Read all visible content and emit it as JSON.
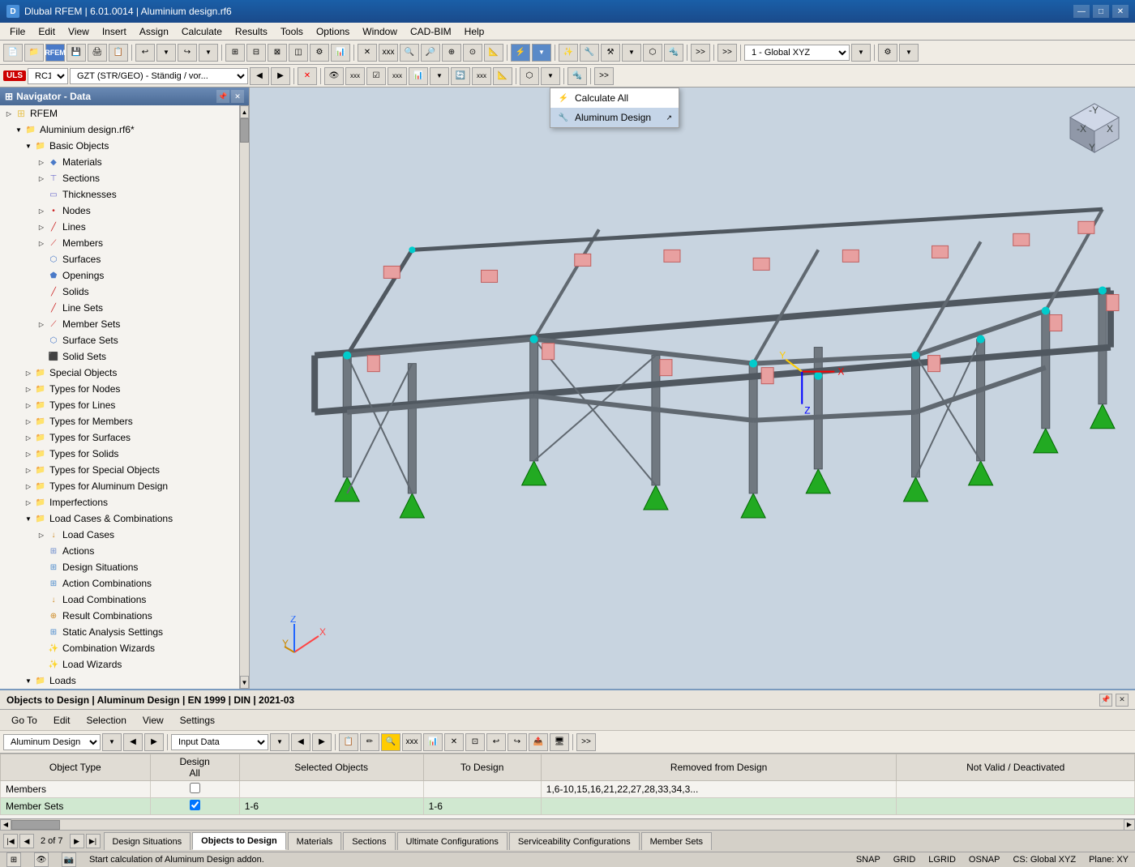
{
  "titleBar": {
    "title": "Dlubal RFEM | 6.01.0014 | Aluminium design.rf6",
    "icon": "D",
    "minBtn": "—",
    "maxBtn": "□",
    "closeBtn": "✕"
  },
  "menuBar": {
    "items": [
      "File",
      "Edit",
      "View",
      "Insert",
      "Assign",
      "Calculate",
      "Results",
      "Tools",
      "Options",
      "Window",
      "CAD-BIM",
      "Help"
    ]
  },
  "toolbar1": {
    "buttons": [
      "📁",
      "💾",
      "🔄",
      "📋",
      "✂",
      "📌",
      "🖨",
      "↩",
      "↪"
    ]
  },
  "toolbar2": {
    "badge": "ULS",
    "combo1": "RC1",
    "combo2": "GZT (STR/GEO) - Ständig / vor...",
    "combo3": "1 - Global XYZ"
  },
  "navigator": {
    "title": "Navigator - Data",
    "rootLabel": "RFEM",
    "items": [
      {
        "label": "Aluminium design.rf6*",
        "level": 1,
        "expanded": true,
        "type": "file"
      },
      {
        "label": "Basic Objects",
        "level": 2,
        "expanded": true,
        "type": "folder"
      },
      {
        "label": "Materials",
        "level": 3,
        "expanded": false,
        "type": "leaf"
      },
      {
        "label": "Sections",
        "level": 3,
        "expanded": false,
        "type": "leaf"
      },
      {
        "label": "Thicknesses",
        "level": 3,
        "expanded": false,
        "type": "leaf"
      },
      {
        "label": "Nodes",
        "level": 3,
        "expanded": false,
        "type": "leaf"
      },
      {
        "label": "Lines",
        "level": 3,
        "expanded": false,
        "type": "leaf"
      },
      {
        "label": "Members",
        "level": 3,
        "expanded": false,
        "type": "leaf"
      },
      {
        "label": "Surfaces",
        "level": 3,
        "expanded": false,
        "type": "leaf"
      },
      {
        "label": "Openings",
        "level": 3,
        "expanded": false,
        "type": "leaf"
      },
      {
        "label": "Solids",
        "level": 3,
        "expanded": false,
        "type": "leaf"
      },
      {
        "label": "Line Sets",
        "level": 3,
        "expanded": false,
        "type": "leaf"
      },
      {
        "label": "Member Sets",
        "level": 3,
        "expanded": false,
        "type": "leaf"
      },
      {
        "label": "Surface Sets",
        "level": 3,
        "expanded": false,
        "type": "leaf"
      },
      {
        "label": "Solid Sets",
        "level": 3,
        "expanded": false,
        "type": "leaf"
      },
      {
        "label": "Special Objects",
        "level": 2,
        "expanded": false,
        "type": "folder"
      },
      {
        "label": "Types for Nodes",
        "level": 2,
        "expanded": false,
        "type": "folder"
      },
      {
        "label": "Types for Lines",
        "level": 2,
        "expanded": false,
        "type": "folder"
      },
      {
        "label": "Types for Members",
        "level": 2,
        "expanded": false,
        "type": "folder"
      },
      {
        "label": "Types for Surfaces",
        "level": 2,
        "expanded": false,
        "type": "folder"
      },
      {
        "label": "Types for Solids",
        "level": 2,
        "expanded": false,
        "type": "folder"
      },
      {
        "label": "Types for Special Objects",
        "level": 2,
        "expanded": false,
        "type": "folder"
      },
      {
        "label": "Types for Aluminum Design",
        "level": 2,
        "expanded": false,
        "type": "folder"
      },
      {
        "label": "Imperfections",
        "level": 2,
        "expanded": false,
        "type": "folder"
      },
      {
        "label": "Load Cases & Combinations",
        "level": 2,
        "expanded": true,
        "type": "folder"
      },
      {
        "label": "Load Cases",
        "level": 3,
        "expanded": false,
        "type": "leaf"
      },
      {
        "label": "Actions",
        "level": 3,
        "expanded": false,
        "type": "leaf"
      },
      {
        "label": "Design Situations",
        "level": 3,
        "expanded": false,
        "type": "leaf",
        "selected": false
      },
      {
        "label": "Action Combinations",
        "level": 3,
        "expanded": false,
        "type": "leaf"
      },
      {
        "label": "Load Combinations",
        "level": 3,
        "expanded": false,
        "type": "leaf"
      },
      {
        "label": "Result Combinations",
        "level": 3,
        "expanded": false,
        "type": "leaf"
      },
      {
        "label": "Static Analysis Settings",
        "level": 3,
        "expanded": false,
        "type": "leaf"
      },
      {
        "label": "Combination Wizards",
        "level": 3,
        "expanded": false,
        "type": "leaf"
      },
      {
        "label": "Load Wizards",
        "level": 3,
        "expanded": false,
        "type": "leaf"
      },
      {
        "label": "Loads",
        "level": 2,
        "expanded": false,
        "type": "folder"
      }
    ]
  },
  "dropdownMenu": {
    "items": [
      {
        "label": "Calculate All",
        "icon": "⚡"
      },
      {
        "label": "Aluminum Design",
        "icon": "🔧"
      }
    ]
  },
  "bottomPanel": {
    "title": "Objects to Design | Aluminum Design | EN 1999 | DIN | 2021-03",
    "menuItems": [
      "Go To",
      "Edit",
      "Selection",
      "View",
      "Settings"
    ],
    "moduleDropdown": "Aluminum Design",
    "dataDropdown": "Input Data",
    "tableHeaders": [
      "Object Type",
      "Design\nAll",
      "Selected Objects",
      "To Design",
      "Removed from Design",
      "Not Valid / Deactivated"
    ],
    "tableRows": [
      {
        "type": "Members",
        "designAll": false,
        "selected": "",
        "toDesign": "",
        "removed": "1,6-10,15,16,21,22,27,28,33,34,3...",
        "notValid": ""
      },
      {
        "type": "Member Sets",
        "designAll": true,
        "selected": "1-6",
        "toDesign": "1-6",
        "removed": "",
        "notValid": ""
      }
    ],
    "pagination": {
      "current": "2",
      "total": "7",
      "label": "of 7"
    },
    "tabs": [
      "Design Situations",
      "Objects to Design",
      "Materials",
      "Sections",
      "Ultimate Configurations",
      "Serviceability Configurations",
      "Member Sets"
    ]
  },
  "statusBar": {
    "message": "Start calculation of Aluminum Design addon.",
    "items": [
      "SNAP",
      "GRID",
      "LGRID",
      "OSNAP"
    ],
    "cs": "CS: Global XYZ",
    "plane": "Plane: XY"
  },
  "bottomToolbarIcons": [
    "📋",
    "✏",
    "🔍",
    "⚙",
    "📊",
    "🔄",
    "📎",
    "↩",
    "↪",
    "📤",
    "🖥"
  ]
}
